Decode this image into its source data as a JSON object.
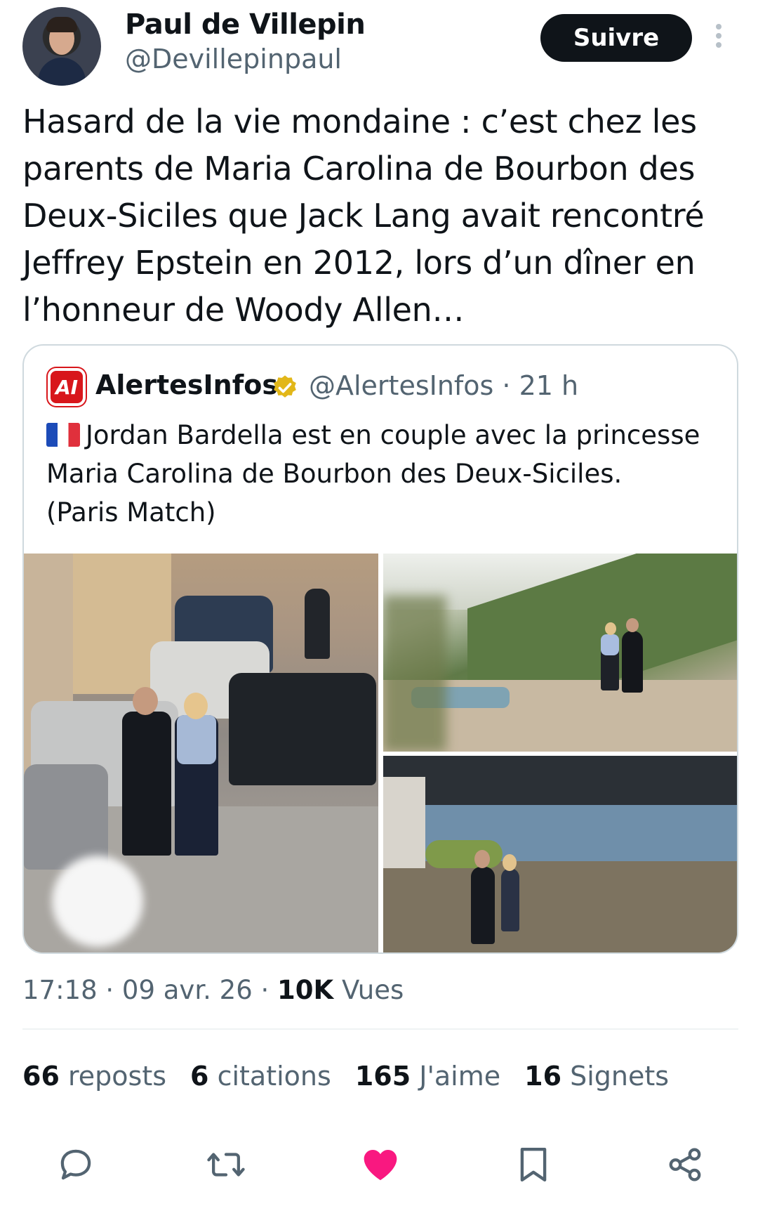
{
  "author": {
    "name": "Paul de Villepin",
    "handle": "@Devillepinpaul",
    "follow_label": "Suivre"
  },
  "tweet": {
    "text": "Hasard de la vie mondaine : c’est chez les\nparents de Maria Carolina de Bourbon des\nDeux-Siciles que Jack Lang avait rencontré\nJeffrey Epstein en 2012, lors d’un dîner en\nl’honneur de Woody Allen…"
  },
  "quote": {
    "logo_text": "AI",
    "name": "AlertesInfos",
    "handle_time": "@AlertesInfos · 21 h",
    "text": "Jordan Bardella est en couple avec la princesse\nMaria Carolina de Bourbon des Deux-Siciles.\n(Paris Match)",
    "photos": [
      "street-photo",
      "hillside-path-photo",
      "rocky-coast-photo"
    ]
  },
  "meta": {
    "time": "17:18 · 09 avr. 26 · ",
    "views_count": "10K",
    "views_label": "Vues"
  },
  "stats": [
    {
      "count": "66",
      "label": "reposts"
    },
    {
      "count": "6",
      "label": "citations"
    },
    {
      "count": "165",
      "label": "J'aime"
    },
    {
      "count": "16",
      "label": "Signets"
    }
  ],
  "colors": {
    "text": "#0f1419",
    "secondary": "#536471",
    "like": "#f91880",
    "verified": "#e2b719"
  },
  "actions": [
    "reply-icon",
    "repost-icon",
    "like-icon",
    "bookmark-icon",
    "share-icon"
  ]
}
